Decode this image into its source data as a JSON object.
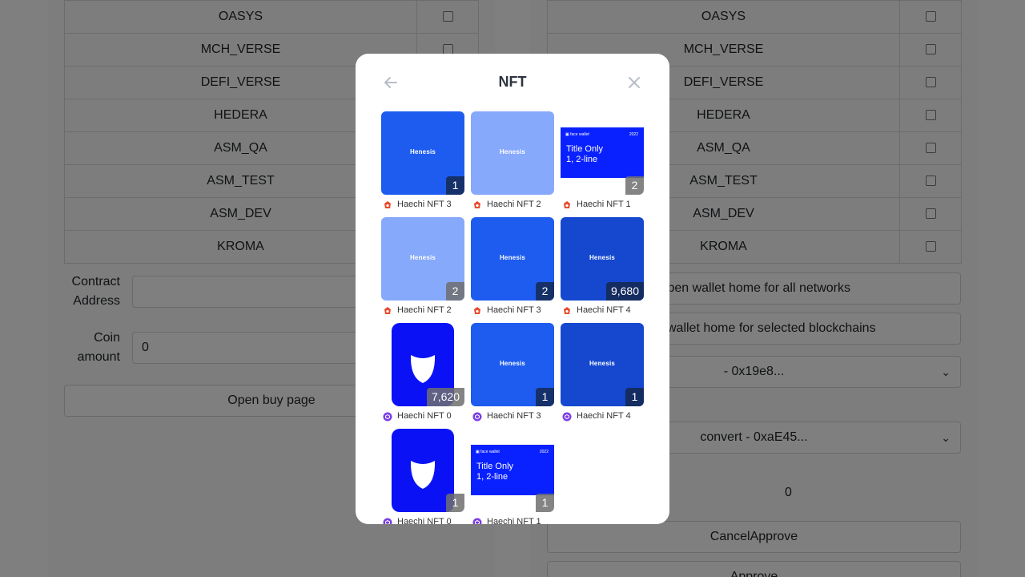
{
  "background": {
    "left_networks": [
      "OASYS",
      "MCH_VERSE",
      "DEFI_VERSE",
      "HEDERA",
      "ASM_QA",
      "ASM_TEST",
      "ASM_DEV",
      "KROMA"
    ],
    "right_networks": [
      "OASYS",
      "MCH_VERSE",
      "DEFI_VERSE",
      "HEDERA",
      "ASM_QA",
      "ASM_TEST",
      "ASM_DEV",
      "KROMA"
    ],
    "contract_address_label": "Contract\nAddress",
    "coin_amount_label": "Coin\namount",
    "coin_amount_value": "0",
    "open_buy_page": "Open buy page",
    "open_wallet_all": "Open wallet home for all networks",
    "open_wallet_selected": "Open wallet home for selected blockchains",
    "select_1": "- 0x19e8...",
    "select_2": "convert - 0xaE45...",
    "amount_value": "0",
    "cancel_approve": "CancelApprove",
    "approve": "Approve"
  },
  "modal": {
    "title": "NFT",
    "items": [
      {
        "name": "Haechi NFT 3",
        "count": "1",
        "network": "red",
        "art": "henesis-blue"
      },
      {
        "name": "Haechi NFT 2",
        "count": "",
        "network": "red",
        "art": "henesis-light"
      },
      {
        "name": "Haechi NFT 1",
        "count": "2",
        "network": "red",
        "art": "banner"
      },
      {
        "name": "Haechi NFT 2",
        "count": "2",
        "network": "red",
        "art": "henesis-light"
      },
      {
        "name": "Haechi NFT 3",
        "count": "2",
        "network": "red",
        "art": "henesis-blue"
      },
      {
        "name": "Haechi NFT 4",
        "count": "9,680",
        "network": "red",
        "art": "henesis-dark"
      },
      {
        "name": "Haechi NFT 0",
        "count": "7,620",
        "network": "purple",
        "art": "face"
      },
      {
        "name": "Haechi NFT 3",
        "count": "1",
        "network": "purple",
        "art": "henesis-blue"
      },
      {
        "name": "Haechi NFT 4",
        "count": "1",
        "network": "purple",
        "art": "henesis-dark"
      },
      {
        "name": "Haechi NFT 0",
        "count": "1",
        "network": "purple",
        "art": "face"
      },
      {
        "name": "Haechi NFT 1",
        "count": "1",
        "network": "purple",
        "art": "banner"
      }
    ],
    "henesis_logo": "Henesis",
    "banner": {
      "brand": "face wallet",
      "year": "2022",
      "title": "Title Only\n1, 2-line"
    }
  },
  "colors": {
    "henesis_blue": "#1d5cef",
    "henesis_light": "#86a9fb",
    "henesis_dark": "#1548cf",
    "banner_blue": "#0a21ff",
    "face_blue": "#0a12f5",
    "network_red": "#e84a2c",
    "network_purple": "#7b3fe4"
  }
}
